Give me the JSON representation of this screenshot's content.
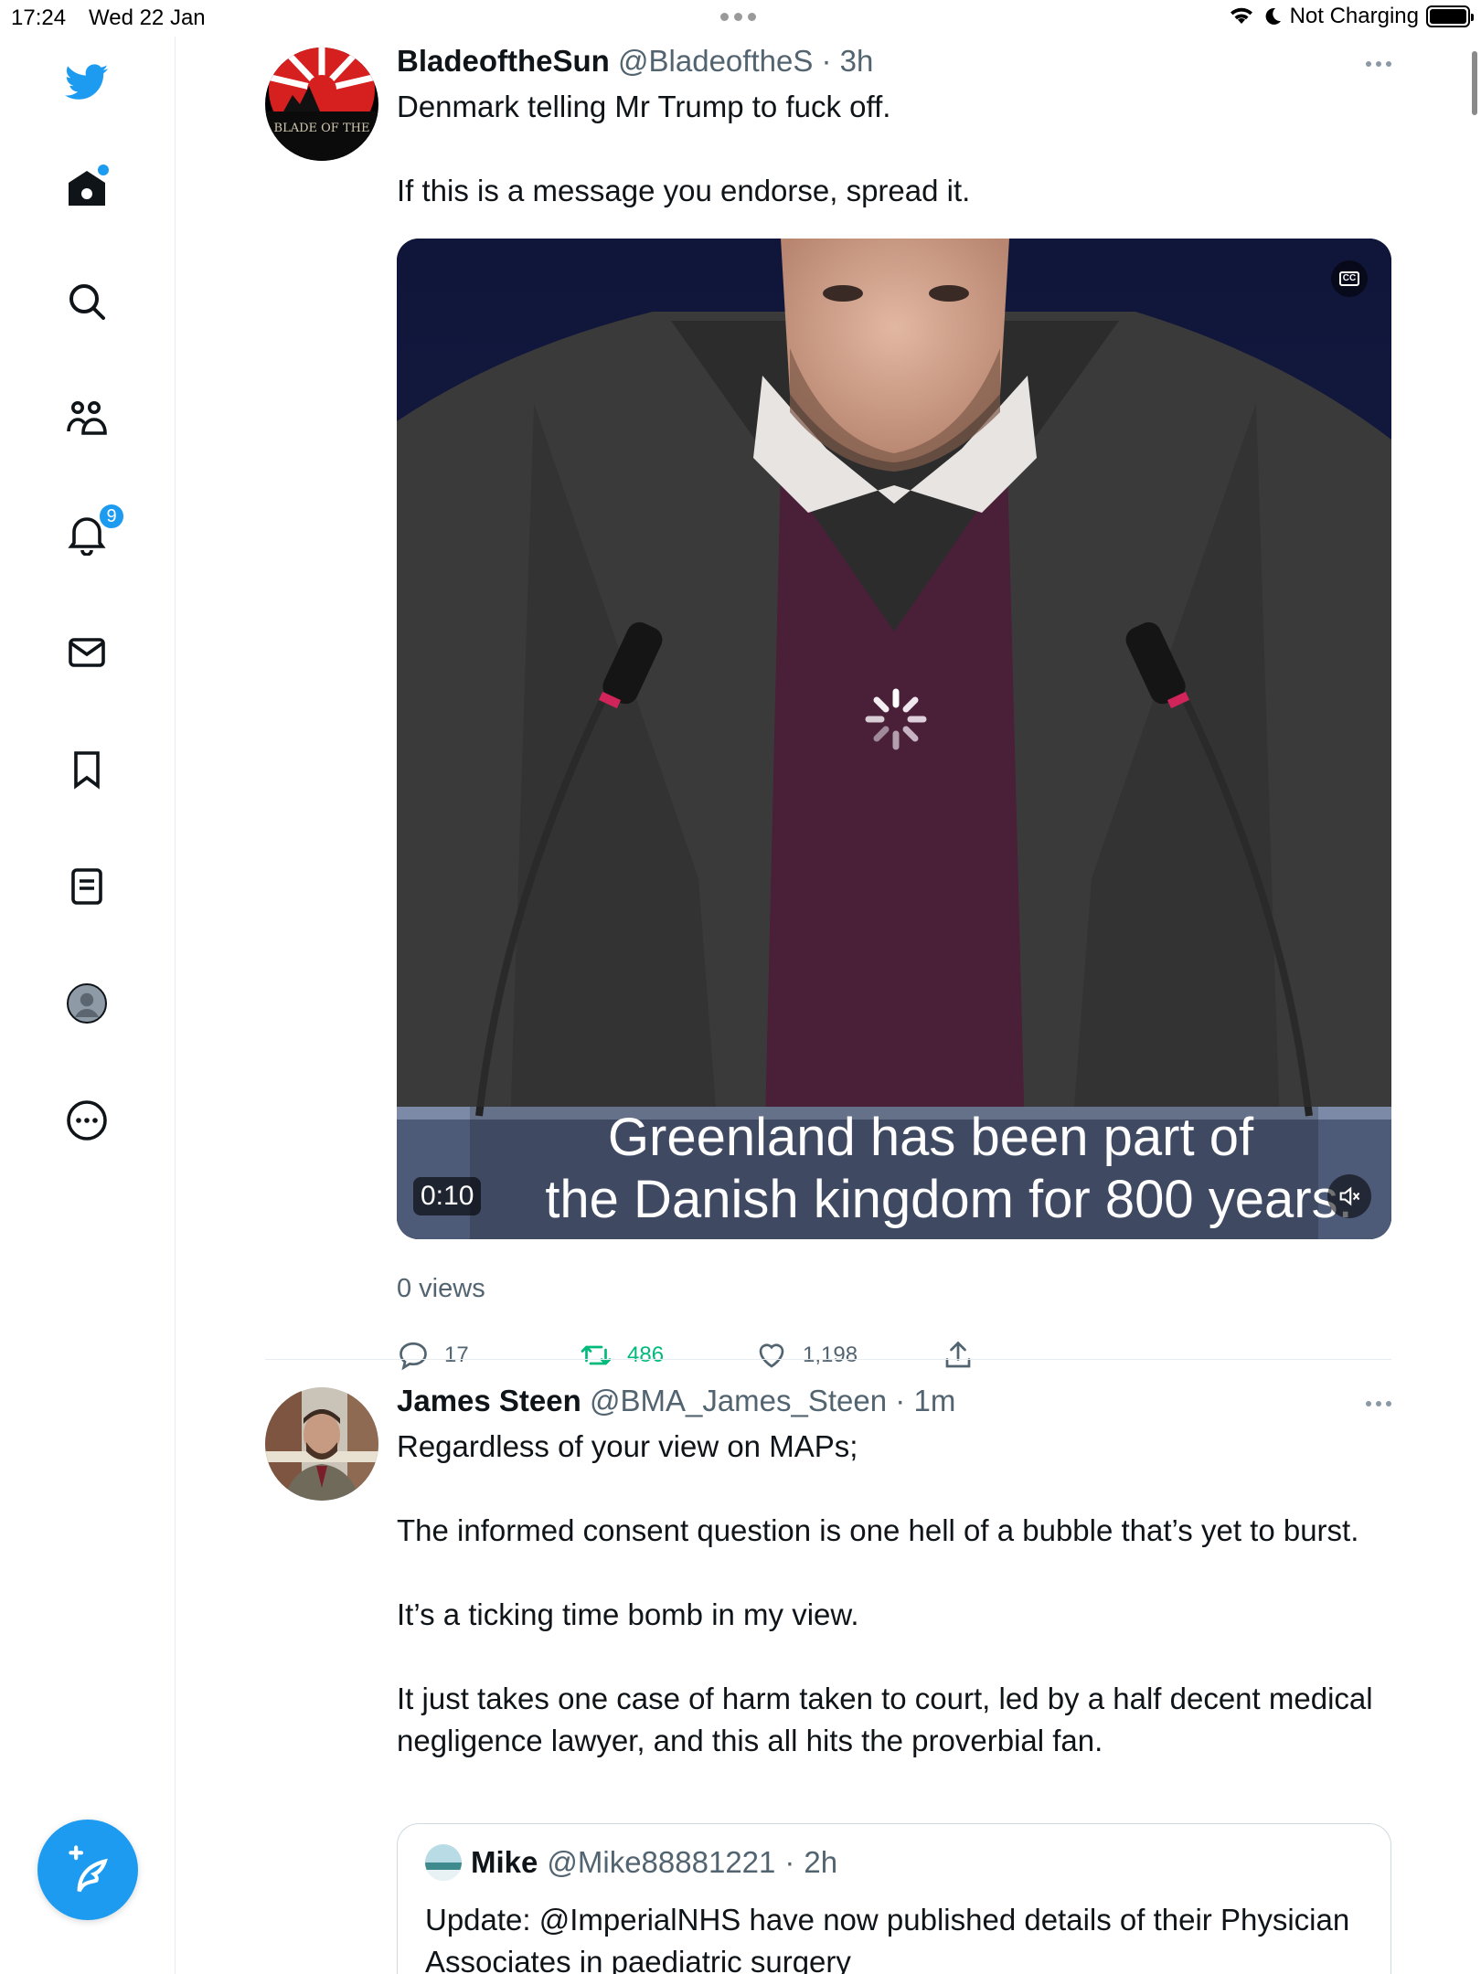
{
  "status_bar": {
    "time": "17:24",
    "date": "Wed 22 Jan",
    "charging": "Not Charging"
  },
  "sidebar": {
    "items": [
      {
        "icon": "twitter-logo-icon"
      },
      {
        "icon": "home-icon",
        "dot": true
      },
      {
        "icon": "search-icon"
      },
      {
        "icon": "communities-icon"
      },
      {
        "icon": "notifications-icon",
        "badge": "9"
      },
      {
        "icon": "messages-icon"
      },
      {
        "icon": "bookmarks-icon"
      },
      {
        "icon": "lists-icon"
      },
      {
        "icon": "profile-icon"
      },
      {
        "icon": "more-icon"
      }
    ],
    "compose_icon": "compose-tweet-icon",
    "accent": "#1d9bf0"
  },
  "tweets": [
    {
      "name": "BladeoftheSun",
      "handle": "@BladeoftheS",
      "time": "3h",
      "avatar_text": "BLADE OF THE",
      "text": [
        "Denmark telling Mr Trump to fuck off.",
        "If this is a message you endorse, spread it."
      ],
      "video": {
        "subtitle_line1": "Greenland has been part of",
        "subtitle_line2": "the Danish kingdom for 800 years.",
        "duration": "0:10"
      },
      "views": "0 views",
      "stats": {
        "replies": "17",
        "retweets": "486",
        "likes": "1,198"
      }
    },
    {
      "name": "James Steen",
      "handle": "@BMA_James_Steen",
      "time": "1m",
      "text": [
        "Regardless of your view on MAPs;",
        "The informed consent question is one hell of a bubble that’s yet to burst.",
        "It’s a ticking time bomb in my view.",
        "It just takes one case of harm taken to court, led by a half decent medical negligence lawyer, and this all hits the proverbial fan."
      ],
      "quote": {
        "name": "Mike",
        "handle": "@Mike88881221",
        "time": "2h",
        "text": "Update: @ImperialNHS have now published details of their Physician Associates in paediatric surgery"
      }
    }
  ],
  "colors": {
    "retweet_green": "#00ba7c",
    "meta_gray": "#536471"
  }
}
